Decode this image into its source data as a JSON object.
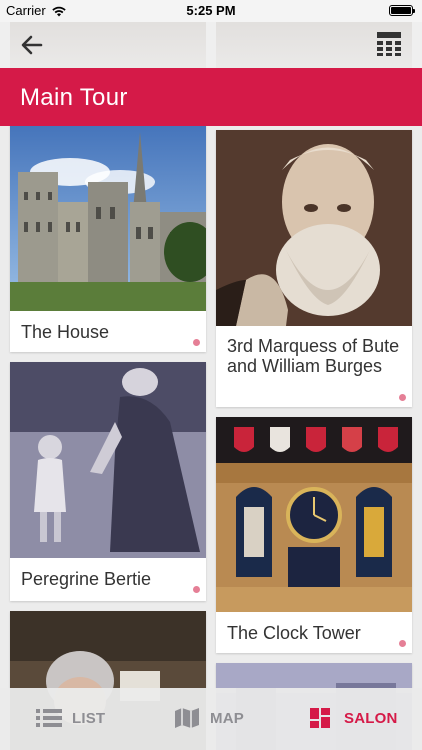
{
  "status": {
    "carrier": "Carrier",
    "time": "5:25 PM"
  },
  "header": {
    "title": "Main Tour"
  },
  "cards": [
    {
      "title": "The House"
    },
    {
      "title": "3rd Marquess of Bute and William Burges"
    },
    {
      "title": "Peregrine Bertie"
    },
    {
      "title": "The Clock Tower"
    }
  ],
  "tabs": [
    {
      "label": "LIST",
      "icon": "list-icon",
      "active": false
    },
    {
      "label": "MAP",
      "icon": "map-icon",
      "active": false
    },
    {
      "label": "SALON",
      "icon": "salon-grid-icon",
      "active": true
    }
  ],
  "colors": {
    "accent": "#d51a48",
    "inactive_tab": "#8e8e93",
    "dot": "#e57f96"
  }
}
